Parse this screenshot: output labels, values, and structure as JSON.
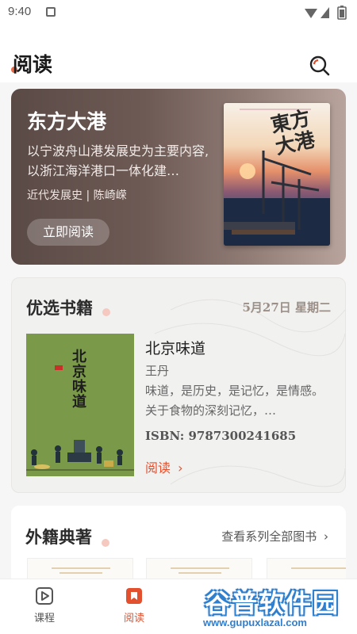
{
  "status_bar": {
    "time": "9:40"
  },
  "header": {
    "title": "阅读",
    "search_icon": "search-icon"
  },
  "hero": {
    "title": "东方大港",
    "description": "以宁波舟山港发展史为主要内容,以浙江海洋港口一体化建…",
    "meta": "近代发展史 | 陈崎嵘",
    "button": "立即阅读",
    "cover_title": "東方大港"
  },
  "featured": {
    "title": "优选书籍",
    "date": "5月27日 星期二",
    "book": {
      "title": "北京味道",
      "author": "王丹",
      "description": "味道，是历史，是记忆，是情感。关于食物的深刻记忆，…",
      "isbn": "ISBN: 9787300241685",
      "read_label": "阅读",
      "cover_title": "北京味道"
    }
  },
  "foreign": {
    "title": "外籍典著",
    "see_all": "查看系列全部图书"
  },
  "tabbar": {
    "tabs": [
      {
        "label": "课程",
        "icon": "play-icon",
        "active": false
      },
      {
        "label": "阅读",
        "icon": "book-icon",
        "active": true
      }
    ]
  },
  "watermark": {
    "text": "谷普软件园",
    "url": "www.gupuxlazal.com"
  },
  "colors": {
    "accent": "#e2502e",
    "tab_active": "#e2502e",
    "tab_inactive": "#555555"
  }
}
